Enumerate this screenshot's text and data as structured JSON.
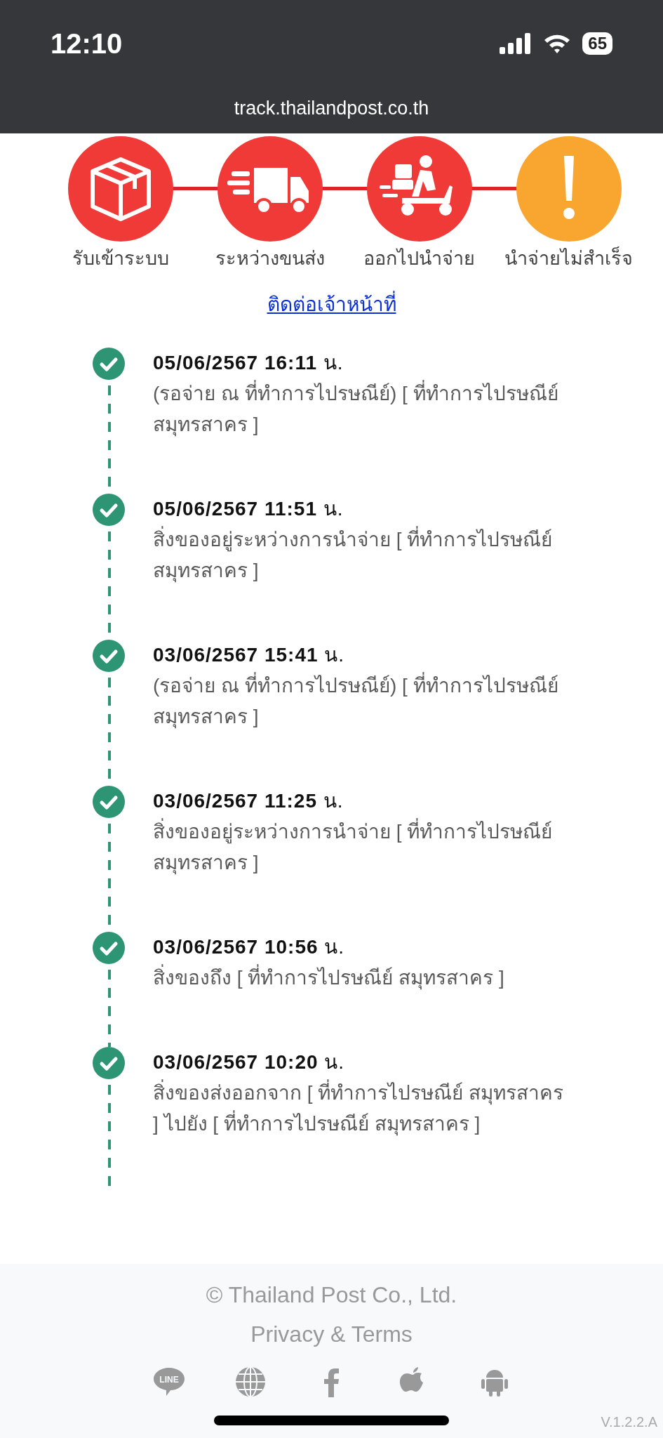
{
  "status_bar": {
    "time": "12:10",
    "battery": "65"
  },
  "address_bar": {
    "url": "track.thailandpost.co.th"
  },
  "steps": [
    {
      "kind": "box",
      "label": "รับเข้าระบบ",
      "color": "#f03a37"
    },
    {
      "kind": "truck",
      "label": "ระหว่างขนส่ง",
      "color": "#f03a37"
    },
    {
      "kind": "scooter",
      "label": "ออกไปนำจ่าย",
      "color": "#f03a37"
    },
    {
      "kind": "alert",
      "label": "นำจ่ายไม่สำเร็จ",
      "color": "#f9a630"
    }
  ],
  "contact_link": "ติดต่อเจ้าหน้าที่",
  "timeline": [
    {
      "datetime": "**05/06/2567 16:11** น.",
      "description": "(รอจ่าย ณ ที่ทำการไปรษณีย์) [ ที่ทำการไปรษณีย์ สมุทรสาคร ]"
    },
    {
      "datetime": "**05/06/2567 11:51** น.",
      "description": "สิ่งของอยู่ระหว่างการนำจ่าย [ ที่ทำการไปรษณีย์ สมุทรสาคร ]"
    },
    {
      "datetime": "**03/06/2567 15:41** น.",
      "description": "(รอจ่าย ณ ที่ทำการไปรษณีย์) [ ที่ทำการไปรษณีย์ สมุทรสาคร ]"
    },
    {
      "datetime": "**03/06/2567 11:25** น.",
      "description": "สิ่งของอยู่ระหว่างการนำจ่าย [ ที่ทำการไปรษณีย์ สมุทรสาคร ]"
    },
    {
      "datetime": "**03/06/2567 10:56** น.",
      "description": "สิ่งของถึง [ ที่ทำการไปรษณีย์ สมุทรสาคร ]"
    },
    {
      "datetime": "**03/06/2567 10:20** น.",
      "description": "สิ่งของส่งออกจาก [ ที่ทำการไปรษณีย์ สมุทรสาคร ] ไปยัง [ ที่ทำการไปรษณีย์ สมุทรสาคร ]"
    }
  ],
  "footer": {
    "copyright": "© Thailand Post Co., Ltd.",
    "privacy_link": "Privacy & Terms",
    "apps": [
      {
        "kind": "line",
        "label": "LINE"
      },
      {
        "kind": "globe"
      },
      {
        "kind": "facebook"
      },
      {
        "kind": "apple"
      },
      {
        "kind": "android"
      }
    ],
    "version": "V.1.2.2.A"
  }
}
